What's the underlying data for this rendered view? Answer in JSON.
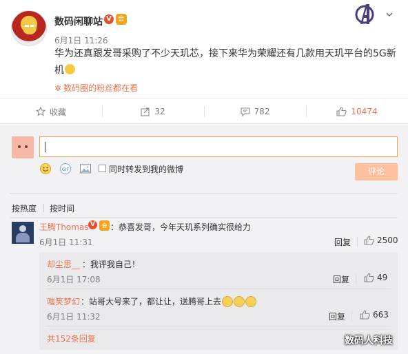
{
  "post": {
    "author": "数码闲聊站",
    "verified_mark": "V",
    "member_mark": "会",
    "time": "6月1日 11:26",
    "text": "华为还真跟发哥采购了不少天玑芯，接下来华为荣耀还有几款用天玑平台的5G新机",
    "fans_label": "数码圈的粉丝都在看"
  },
  "actions": {
    "favorite_label": "收藏",
    "repost_count": "32",
    "comment_count": "782",
    "like_count": "10474"
  },
  "composer": {
    "sync_label": "同时转发到我的微博",
    "submit_label": "评论"
  },
  "sort": {
    "hot": "按热度",
    "time": "按时间"
  },
  "comment": {
    "author": "王腾Thomas",
    "verified_mark": "V",
    "member_mark": "会",
    "text": "：恭喜发哥，今年天玑系列确实很给力",
    "time": "6月1日 11:31",
    "reply_label": "回复",
    "like_count": "2500"
  },
  "replies": [
    {
      "author": "却尘思__",
      "text": "：我评我自己！",
      "time": "6月1日 17:08",
      "reply_label": "回复",
      "like_count": "49"
    },
    {
      "author": "嗤笑梦幻",
      "text": "：站哥大号来了，都让让，送腾哥上去",
      "time": "6月1日 11:32",
      "reply_label": "回复",
      "like_count": "663"
    }
  ],
  "more_replies": "共152条回复",
  "watermark": "数码人科技",
  "colors": {
    "accent": "#eb7350",
    "input_border": "#f2a85c",
    "submit_bg": "#ffc09f"
  },
  "icons": [
    "star-icon",
    "repost-icon",
    "comment-icon",
    "thumb-up-icon",
    "smile-icon",
    "gif-icon",
    "image-icon",
    "chevron-down-icon",
    "avengers-logo-icon"
  ]
}
